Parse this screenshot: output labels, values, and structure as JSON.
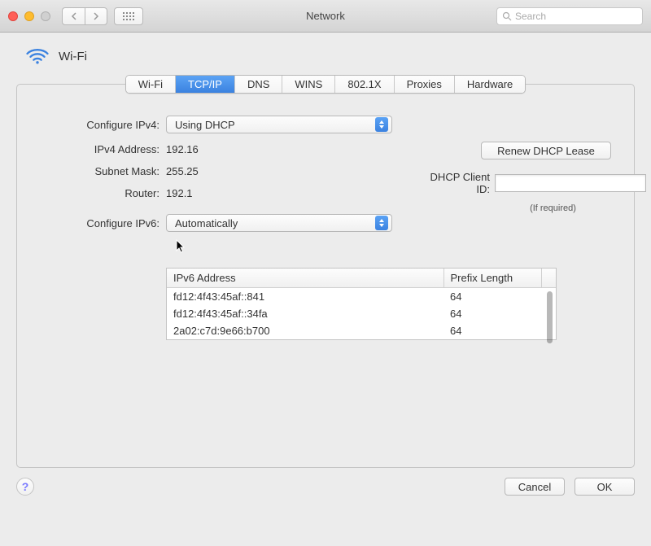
{
  "window": {
    "title": "Network",
    "search_placeholder": "Search"
  },
  "header": {
    "label": "Wi-Fi"
  },
  "tabs": [
    {
      "label": "Wi-Fi",
      "active": false
    },
    {
      "label": "TCP/IP",
      "active": true
    },
    {
      "label": "DNS",
      "active": false
    },
    {
      "label": "WINS",
      "active": false
    },
    {
      "label": "802.1X",
      "active": false
    },
    {
      "label": "Proxies",
      "active": false
    },
    {
      "label": "Hardware",
      "active": false
    }
  ],
  "ipv4": {
    "configure_label": "Configure IPv4:",
    "configure_value": "Using DHCP",
    "address_label": "IPv4 Address:",
    "address_value": "192.16",
    "subnet_label": "Subnet Mask:",
    "subnet_value": "255.25",
    "router_label": "Router:",
    "router_value": "192.1"
  },
  "dhcp": {
    "renew_label": "Renew DHCP Lease",
    "client_id_label": "DHCP Client ID:",
    "client_id_value": "",
    "if_required": "(If required)"
  },
  "ipv6": {
    "configure_label": "Configure IPv6:",
    "configure_value": "Automatically",
    "col_address": "IPv6 Address",
    "col_prefix": "Prefix Length",
    "rows": [
      {
        "addr": "fd12:4f43:45af::841",
        "prefix": "64"
      },
      {
        "addr": "fd12:4f43:45af::34fa",
        "prefix": "64"
      },
      {
        "addr": "2a02:c7d:9e66:b700",
        "prefix": "64"
      }
    ]
  },
  "footer": {
    "cancel": "Cancel",
    "ok": "OK"
  }
}
